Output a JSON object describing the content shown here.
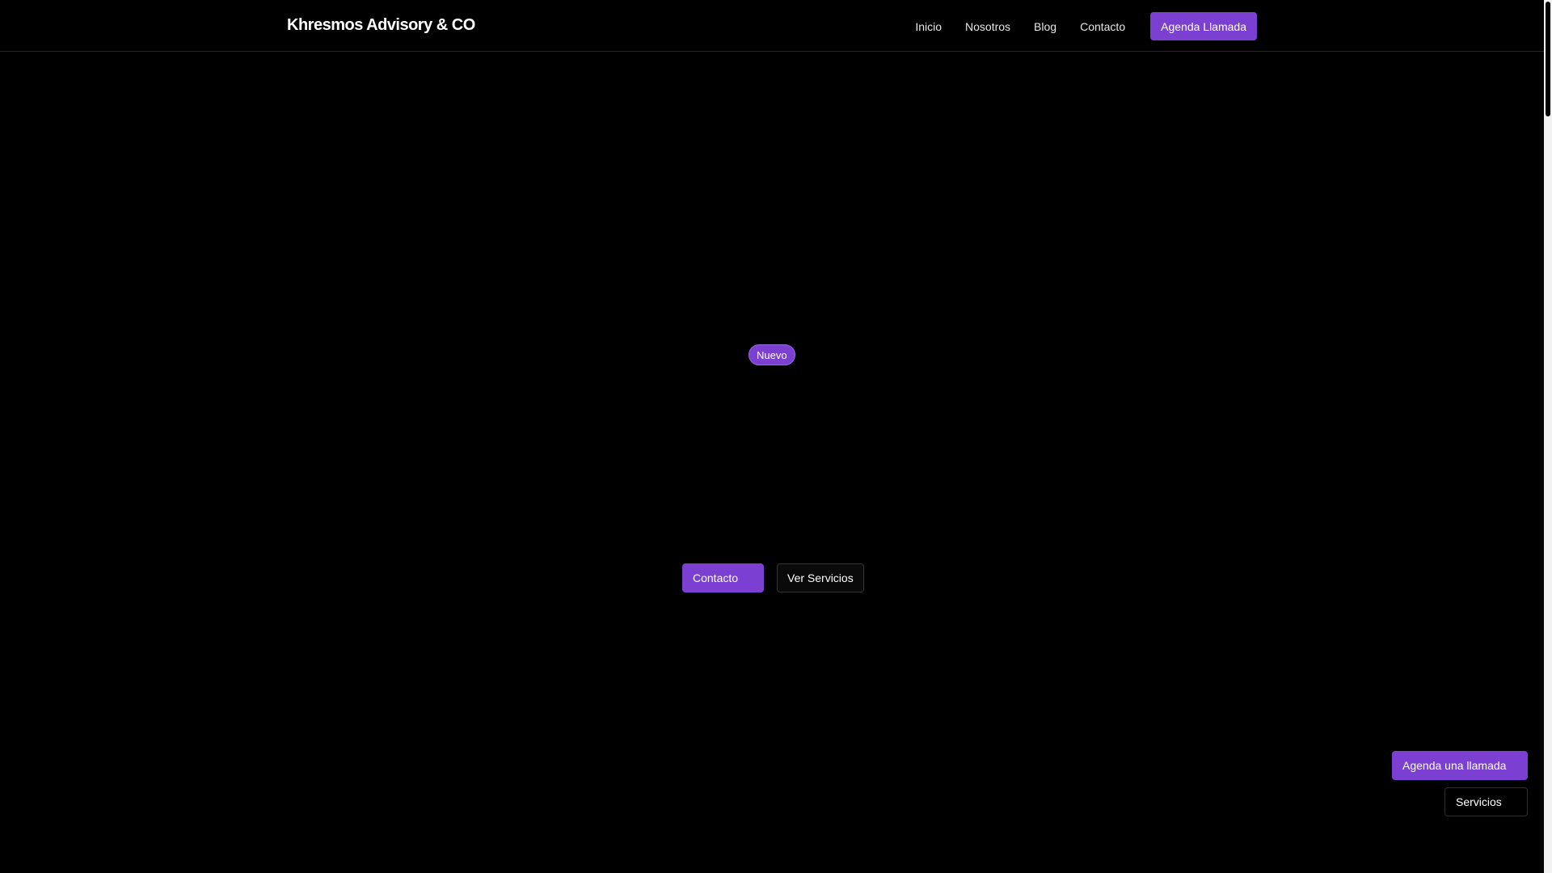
{
  "header": {
    "brand": "Khresmos Advisory & CO",
    "nav": {
      "inicio": "Inicio",
      "nosotros": "Nosotros",
      "blog": "Blog",
      "contacto": "Contacto"
    },
    "cta_label": "Agenda Llamada"
  },
  "hero": {
    "badge": "Nuevo",
    "primary_button": "Contacto",
    "secondary_button": "Ver Servicios"
  },
  "floating": {
    "primary_button": "Agenda una llamada",
    "secondary_button": "Servicios"
  },
  "colors": {
    "background": "#000000",
    "accent": "#7b3fd1",
    "text": "#ffffff"
  }
}
